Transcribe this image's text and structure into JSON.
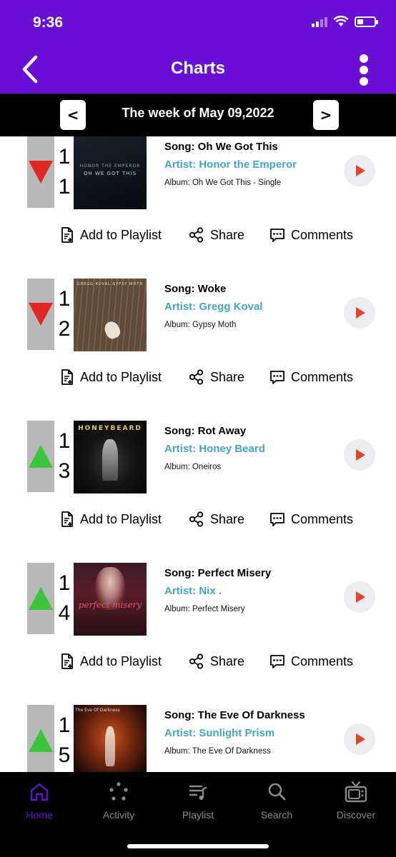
{
  "status_bar": {
    "time": "9:36"
  },
  "header": {
    "title": "Charts"
  },
  "week_selector": {
    "prev_label": "<",
    "next_label": ">",
    "label": "The week of May 09,2022"
  },
  "actions": {
    "add_label": "Add to Playlist",
    "share_label": "Share",
    "comments_label": "Comments"
  },
  "entries": [
    {
      "rank_digits": [
        "1",
        "1"
      ],
      "trend": "down",
      "song": "Song: Oh We Got This",
      "artist": "Artist: Honor the Emperor",
      "album": "Album: Oh We Got This - Single",
      "art_caption": "HONOR THE EMPEROR",
      "art_caption2": "OH WE GOT THIS"
    },
    {
      "rank_digits": [
        "1",
        "2"
      ],
      "trend": "down",
      "song": "Song: Woke",
      "artist": "Artist: Gregg Koval",
      "album": "Album: Gypsy Moth",
      "art_caption": "GREGG KOVAL     GYPSY MOTH",
      "art_caption2": ""
    },
    {
      "rank_digits": [
        "1",
        "3"
      ],
      "trend": "up",
      "song": "Song: Rot Away",
      "artist": "Artist: Honey Beard",
      "album": "Album: Oneiros",
      "art_caption": "HONEYBEARD",
      "art_caption2": ""
    },
    {
      "rank_digits": [
        "1",
        "4"
      ],
      "trend": "up",
      "song": "Song: Perfect Misery",
      "artist": "Artist: Nix .",
      "album": "Album: Perfect Misery",
      "art_caption": "perfect misery",
      "art_caption2": ""
    },
    {
      "rank_digits": [
        "1",
        "5"
      ],
      "trend": "up",
      "song": "Song: The Eve Of Darkness",
      "artist": "Artist: Sunlight Prism",
      "album": "Album: The Eve Of Darkness",
      "art_caption": "The Eve Of Darkness",
      "art_caption2": ""
    }
  ],
  "tab_bar": {
    "items": [
      {
        "label": "Home",
        "icon": "home-icon",
        "active": true
      },
      {
        "label": "Activity",
        "icon": "activity-icon",
        "active": false
      },
      {
        "label": "Playlist",
        "icon": "playlist-icon",
        "active": false
      },
      {
        "label": "Search",
        "icon": "search-icon",
        "active": false
      },
      {
        "label": "Discover",
        "icon": "tv-icon",
        "active": false
      }
    ]
  },
  "colors": {
    "brand_purple": "#6a10d6",
    "artist_blue": "#41a7c9",
    "trend_down": "#e02822",
    "trend_up": "#3cc43c",
    "play_red": "#e3452b"
  }
}
